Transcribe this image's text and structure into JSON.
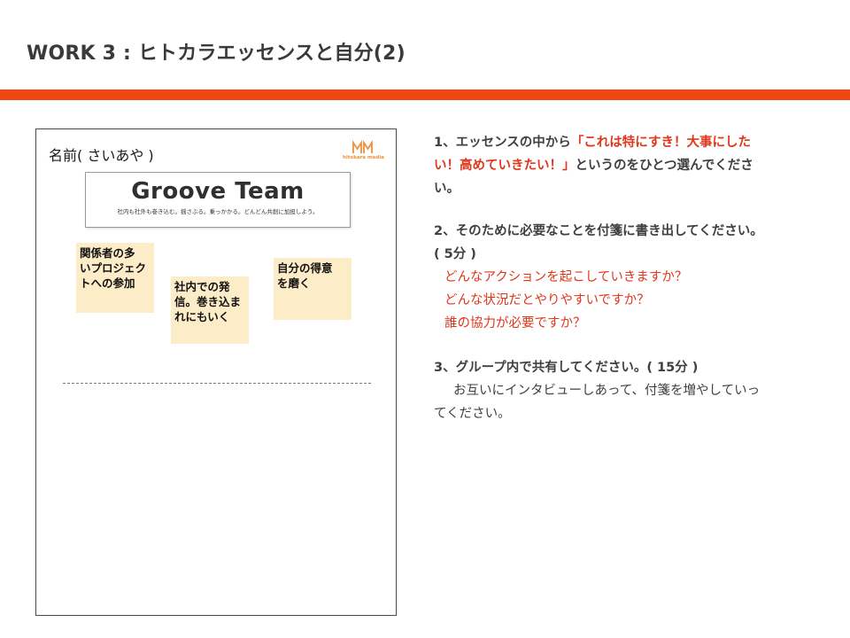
{
  "slide": {
    "title": "WORK 3 : ヒトカラエッセンスと自分(2)",
    "accent_color": "#f24612"
  },
  "worksheet": {
    "name_label": "名前(  さいあや  )",
    "logo_text": "hitokara media",
    "banner": {
      "title": "Groove Team",
      "tagline": "社内も社外も巻き込む。揺さぶる。乗っかかる。どんどん共創に加担しよう。"
    },
    "sticky_notes": [
      {
        "lines": [
          "関係者の多",
          "いプロジェク",
          "トへの参加"
        ]
      },
      {
        "lines": [
          "社内での発",
          "信。巻き込ま",
          "れにもいく"
        ]
      },
      {
        "lines": [
          "自分の得意",
          "を磨く"
        ]
      }
    ],
    "sticky_color": "#fdecc8"
  },
  "instructions": {
    "step1": {
      "line1_prefix": "1、エッセンスの中から",
      "line1_highlight": "「これは特にすき！大事にした",
      "line2_highlight": "い！高めていきたい！」",
      "line2_suffix": "というのをひとつ選んでくださ",
      "line3": "い。"
    },
    "step2": {
      "line1": "2、そのために必要なことを付箋に書き出してください。",
      "line2": "( 5分 )",
      "questions": [
        "どんなアクションを起こしていきますか？",
        "どんな状況だとやりやすいですか？",
        "誰の協力が必要ですか？"
      ]
    },
    "step3": {
      "line1": "3、グループ内で共有してください。( 15分 )",
      "line2": "お互いにインタビューしあって、付箋を増やしていっ",
      "line3": "てください。"
    },
    "highlight_color": "#e2361a"
  }
}
